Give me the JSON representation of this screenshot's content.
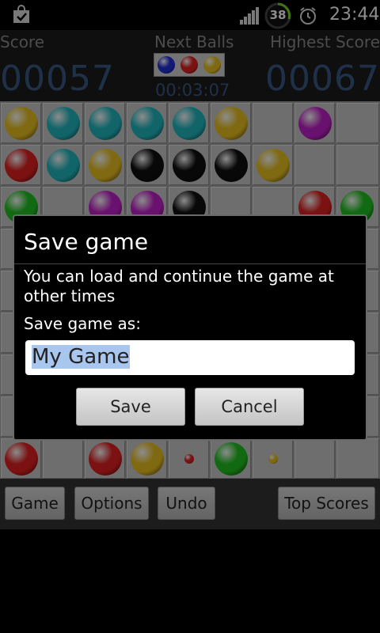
{
  "status_bar": {
    "time": "23:44",
    "battery_level": "38",
    "icons": [
      "shopping-bag-icon",
      "signal-icon",
      "battery-icon",
      "alarm-clock-icon"
    ]
  },
  "header": {
    "score_label": "Score",
    "next_balls_label": "Next Balls",
    "highest_score_label": "Highest Score",
    "score": "00057",
    "highest_score": "00067",
    "timer": "00:03:07",
    "next_balls": [
      "blue",
      "red",
      "yellow"
    ]
  },
  "colors": {
    "yellow": "#e8c020",
    "teal": "#20b8c0",
    "magenta": "#c020c8",
    "red": "#e02020",
    "black": "#101010",
    "green": "#20c020",
    "blue": "#2030d8",
    "score_blue": "#3a5a86"
  },
  "board": {
    "visible_rows": [
      [
        "yellow",
        "teal",
        "teal",
        "teal",
        "teal",
        "yellow",
        null,
        "magenta",
        null
      ],
      [
        "red",
        "teal",
        "yellow",
        "black",
        "black",
        "black",
        "yellow",
        null,
        null
      ],
      [
        "green",
        null,
        "magenta",
        "magenta",
        "black",
        null,
        null,
        "red",
        "green"
      ],
      [
        null,
        null,
        null,
        null,
        null,
        null,
        null,
        null,
        null
      ],
      [
        null,
        null,
        null,
        null,
        null,
        null,
        null,
        null,
        null
      ],
      [
        null,
        null,
        null,
        null,
        null,
        null,
        null,
        null,
        null
      ],
      [
        null,
        null,
        null,
        null,
        null,
        null,
        null,
        null,
        null
      ],
      [
        null,
        null,
        null,
        null,
        null,
        null,
        null,
        null,
        null
      ],
      [
        "red",
        null,
        "red",
        "yellow",
        "red-small",
        "green",
        "yellow-small",
        null,
        null
      ]
    ]
  },
  "bottom_bar": {
    "game": "Game",
    "options": "Options",
    "undo": "Undo",
    "top_scores": "Top Scores"
  },
  "dialog": {
    "title": "Save game",
    "message": "You can load and continue the game at other times",
    "input_label": "Save game as:",
    "input_value": "My Game",
    "save": "Save",
    "cancel": "Cancel"
  }
}
